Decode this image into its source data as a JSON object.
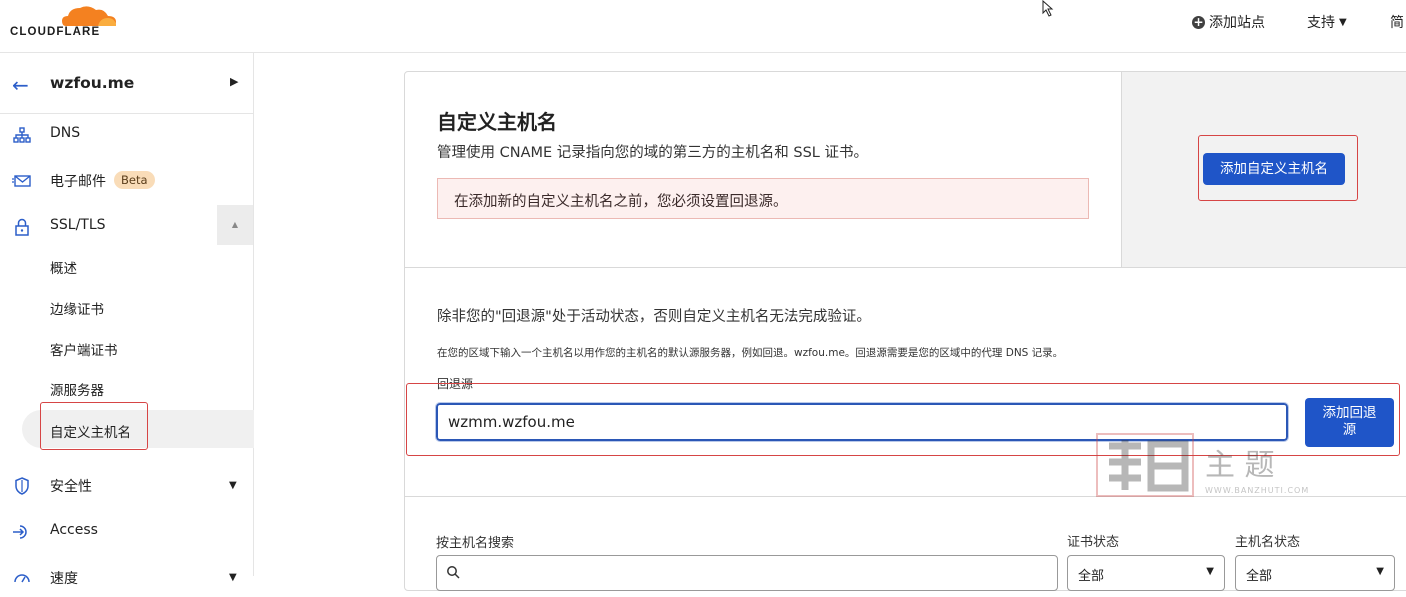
{
  "header": {
    "logo_text": "CLOUDFLARE",
    "add_site_label": "添加站点",
    "support_label": "支持",
    "language_label": "简"
  },
  "sidebar": {
    "site_name": "wzfou.me",
    "items": [
      {
        "label": "DNS",
        "icon": "network-icon"
      },
      {
        "label": "电子邮件",
        "icon": "email-icon",
        "badge": "Beta"
      },
      {
        "label": "SSL/TLS",
        "icon": "lock-icon"
      }
    ],
    "ssl_sub_items": [
      "概述",
      "边缘证书",
      "客户端证书",
      "源服务器",
      "自定义主机名"
    ],
    "more_items": [
      {
        "label": "安全性",
        "icon": "shield-icon"
      },
      {
        "label": "Access",
        "icon": "access-icon"
      },
      {
        "label": "速度",
        "icon": "speed-icon"
      }
    ]
  },
  "main": {
    "title": "自定义主机名",
    "description": "管理使用 CNAME 记录指向您的域的第三方的主机名和 SSL 证书。",
    "warning": "在添加新的自定义主机名之前，您必须设置回退源。",
    "add_hostname_button": "添加自定义主机名",
    "fallback_info": "除非您的\"回退源\"处于活动状态，否则自定义主机名无法完成验证。",
    "fallback_hint": "在您的区域下输入一个主机名以用作您的主机名的默认源服务器，例如回退。wzfou.me。回退源需要是您的区域中的代理 DNS 记录。",
    "fallback_label": "回退源",
    "fallback_value": "wzmm.wzfou.me",
    "add_fallback_button_line1": "添加回退",
    "add_fallback_button_line2": "源",
    "search_label": "按主机名搜索",
    "cert_status_label": "证书状态",
    "host_status_label": "主机名状态",
    "cert_status_value": "全部",
    "host_status_value": "全部"
  },
  "watermark": {
    "main_text": "主 题",
    "url_text": "WWW.BANZHUTI.COM"
  },
  "colors": {
    "primary": "#1f55c8",
    "highlight_box": "#d64545",
    "badge_bg": "#f9dcb8",
    "warning_bg": "#fdf0ef"
  }
}
